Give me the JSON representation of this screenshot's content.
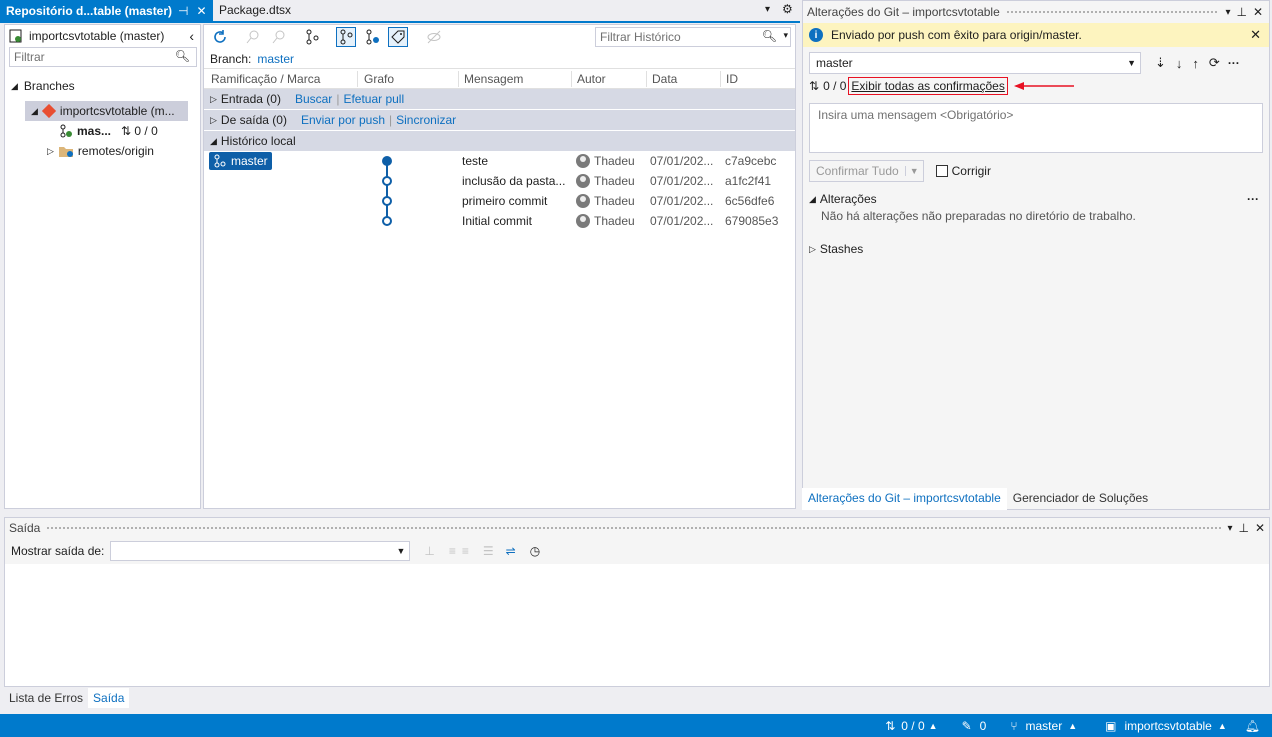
{
  "tabs": {
    "repo_tab": "Repositório d...table (master)",
    "package_tab": "Package.dtsx"
  },
  "repo_explorer": {
    "repo_title": "importcsvtotable (master)",
    "filter_placeholder": "Filtrar",
    "branches_label": "Branches",
    "repo_node": "importcsvtotable (m...",
    "branch_node": "mas...",
    "branch_sync": "⇅ 0 / 0",
    "remotes_node": "remotes/origin"
  },
  "history": {
    "filter_placeholder": "Filtrar Histórico",
    "branch_label": "Branch:",
    "branch_value": "master",
    "columns": [
      "Ramificação / Marca",
      "Grafo",
      "Mensagem",
      "Autor",
      "Data",
      "ID"
    ],
    "incoming": {
      "label": "Entrada (0)",
      "links": [
        "Buscar",
        "Efetuar pull"
      ]
    },
    "outgoing": {
      "label": "De saída (0)",
      "links": [
        "Enviar por push",
        "Sincronizar"
      ]
    },
    "local_label": "Histórico local",
    "branch_badge": "master",
    "commits": [
      {
        "message": "teste",
        "author": "Thadeu",
        "date": "07/01/202...",
        "id": "c7a9cebc"
      },
      {
        "message": "inclusão da pasta...",
        "author": "Thadeu",
        "date": "07/01/202...",
        "id": "a1fc2f41"
      },
      {
        "message": "primeiro commit",
        "author": "Thadeu",
        "date": "07/01/202...",
        "id": "6c56dfe6"
      },
      {
        "message": "Initial commit",
        "author": "Thadeu",
        "date": "07/01/202...",
        "id": "679085e3"
      }
    ]
  },
  "git_changes": {
    "title": "Alterações do Git – importcsvtotable",
    "info_message": "Enviado por push com êxito para origin/master.",
    "branch_select": "master",
    "sync_counts": "0 / 0",
    "show_all_link": "Exibir todas as confirmações",
    "message_placeholder": "Insira uma mensagem <Obrigatório>",
    "commit_button": "Confirmar Tudo",
    "amend_label": "Corrigir",
    "changes_label": "Alterações",
    "no_changes_text": "Não há alterações não preparadas no diretório de trabalho.",
    "stashes_label": "Stashes",
    "bottom_tabs": [
      "Alterações do Git – importcsvtotable",
      "Gerenciador de Soluções"
    ]
  },
  "output": {
    "title": "Saída",
    "show_output_label": "Mostrar saída de:",
    "source_value": ""
  },
  "bottom_tabs": [
    "Lista de Erros",
    "Saída"
  ],
  "status_bar": {
    "sync": "0 / 0",
    "pencil_count": "0",
    "branch": "master",
    "repo": "importcsvtotable"
  },
  "colors": {
    "accent": "#007acc",
    "info_bg": "#fdf4bf",
    "annotation_red": "#e81123"
  }
}
